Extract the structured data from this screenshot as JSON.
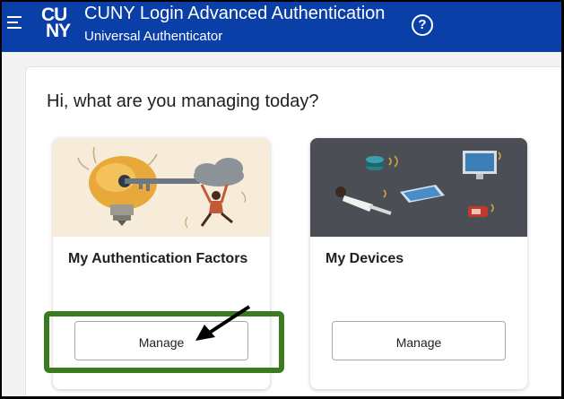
{
  "header": {
    "logo_top": "CU",
    "logo_bottom": "NY",
    "title": "CUNY Login Advanced Authentication",
    "subtitle": "Universal Authenticator",
    "help_symbol": "?"
  },
  "main": {
    "greeting": "Hi, what are you managing today?",
    "cards": [
      {
        "title": "My Authentication Factors",
        "button_label": "Manage",
        "illustration": "lightbulb-key-illustration"
      },
      {
        "title": "My Devices",
        "button_label": "Manage",
        "illustration": "devices-illustration"
      }
    ]
  },
  "annotations": {
    "highlight_color": "#3b7a1f",
    "arrow_color": "#000000"
  },
  "colors": {
    "header_bg": "#0a3fa8",
    "page_bg": "#f3f3f3"
  }
}
